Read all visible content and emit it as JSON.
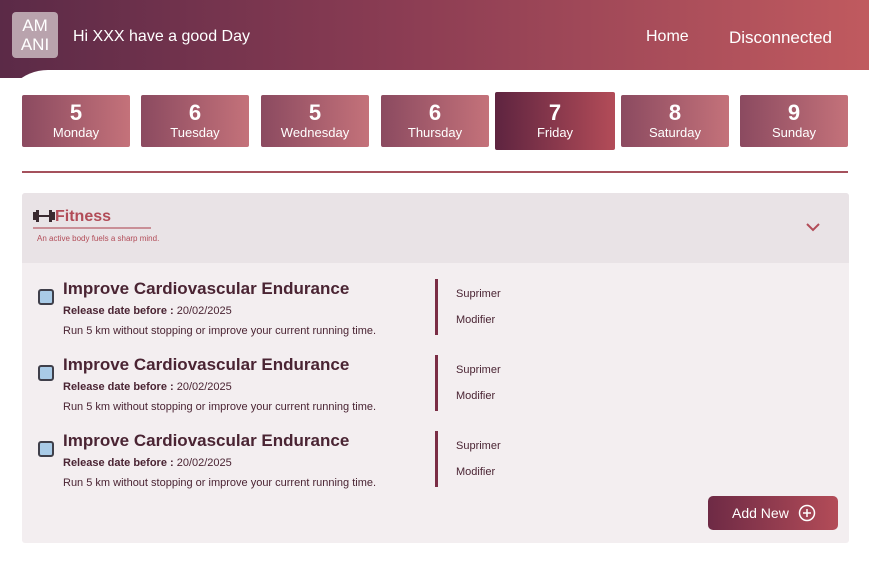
{
  "header": {
    "logo_line1": "AM",
    "logo_line2": "ANI",
    "greeting": "Hi XXX have a good Day",
    "nav": {
      "home": "Home",
      "disconnected": "Disconnected"
    }
  },
  "days": [
    {
      "num": "5",
      "name": "Monday"
    },
    {
      "num": "6",
      "name": "Tuesday"
    },
    {
      "num": "5",
      "name": "Wednesday"
    },
    {
      "num": "6",
      "name": "Thursday"
    },
    {
      "num": "7",
      "name": "Friday",
      "active": true
    },
    {
      "num": "8",
      "name": "Saturday"
    },
    {
      "num": "9",
      "name": "Sunday"
    }
  ],
  "section": {
    "icon": "dumbbell-icon",
    "title": "Fitness",
    "subtitle": "An active body fuels a sharp mind.",
    "chevron": "chevron-down-icon"
  },
  "tasks": [
    {
      "title": "Improve Cardiovascular Endurance",
      "date_label": "Release date before :",
      "date_value": " 20/02/2025",
      "description": "Run 5 km without stopping or improve your current running time.",
      "delete": "Suprimer",
      "edit": "Modifier"
    },
    {
      "title": "Improve Cardiovascular Endurance",
      "date_label": "Release date before :",
      "date_value": " 20/02/2025",
      "description": "Run 5 km without stopping or improve your current running time.",
      "delete": "Suprimer",
      "edit": "Modifier"
    },
    {
      "title": "Improve Cardiovascular Endurance",
      "date_label": "Release date before :",
      "date_value": " 20/02/2025",
      "description": "Run 5 km without stopping or improve your current running time.",
      "delete": "Suprimer",
      "edit": "Modifier"
    }
  ],
  "add_button": {
    "label": "Add New",
    "icon": "plus-circle-icon"
  },
  "colors": {
    "header_start": "#5b2a47",
    "header_end": "#c05a5f",
    "accent": "#b24c58",
    "text_dark": "#4a2433"
  }
}
